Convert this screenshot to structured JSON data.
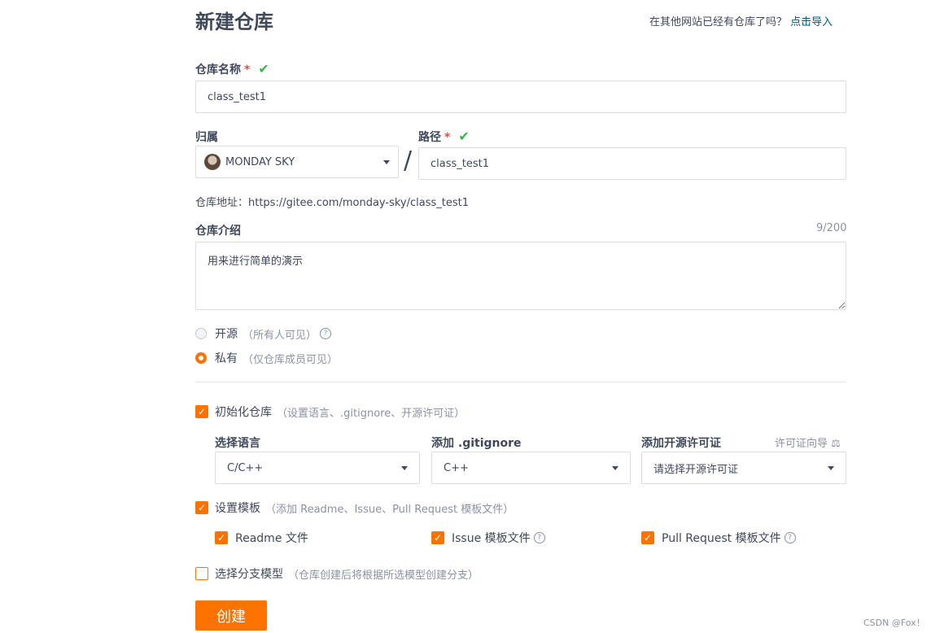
{
  "page": {
    "title": "新建仓库",
    "import_question": "在其他网站已经有仓库了吗？",
    "import_link": "点击导入"
  },
  "repo_name": {
    "label": "仓库名称",
    "required": "*",
    "value": "class_test1"
  },
  "owner": {
    "label": "归属",
    "value": "MONDAY SKY"
  },
  "separator": "/",
  "path": {
    "label": "路径",
    "required": "*",
    "value": "class_test1"
  },
  "address": "仓库地址：https://gitee.com/monday-sky/class_test1",
  "description": {
    "label": "仓库介绍",
    "counter": "9/200",
    "value": "用来进行简单的演示"
  },
  "visibility": [
    {
      "label": "开源",
      "hint": "（所有人可见）",
      "selected": false
    },
    {
      "label": "私有",
      "hint": "（仅仓库成员可见）",
      "selected": true
    }
  ],
  "init_repo": {
    "label": "初始化仓库",
    "hint": "（设置语言、.gitignore、开源许可证）",
    "checked": true,
    "language": {
      "label": "选择语言",
      "value": "C/C++"
    },
    "gitignore": {
      "label": "添加 .gitignore",
      "value": "C++"
    },
    "license": {
      "label": "添加开源许可证",
      "guide": "许可证向导",
      "value": "请选择开源许可证"
    }
  },
  "template": {
    "label": "设置模板",
    "hint": "（添加 Readme、Issue、Pull Request 模板文件）",
    "checked": true,
    "items": [
      {
        "label": "Readme 文件",
        "checked": true
      },
      {
        "label": "Issue 模板文件",
        "checked": true
      },
      {
        "label": "Pull Request 模板文件",
        "checked": true
      }
    ]
  },
  "branch_model": {
    "label": "选择分支模型",
    "hint": "（仓库创建后将根据所选模型创建分支）",
    "checked": false
  },
  "submit_label": "创建",
  "watermark": "CSDN @Fox！",
  "colors": {
    "accent": "#fe7300",
    "check_green": "#3cb34f",
    "required_red": "#e74c3c",
    "link": "#005980"
  }
}
